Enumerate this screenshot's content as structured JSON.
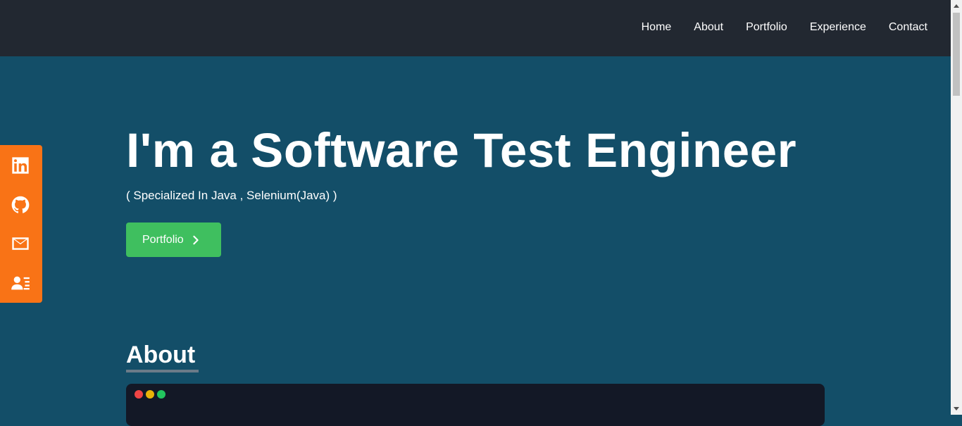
{
  "nav": {
    "items": [
      {
        "label": "Home"
      },
      {
        "label": "About"
      },
      {
        "label": "Portfolio"
      },
      {
        "label": "Experience"
      },
      {
        "label": "Contact"
      }
    ]
  },
  "hero": {
    "title": "I'm a Software Test Engineer",
    "subtitle": "( Specialized In Java , Selenium(Java) )",
    "cta_label": "Portfolio",
    "cta_icon": "chevron-right-icon"
  },
  "social": {
    "icons": [
      "linkedin-icon",
      "github-icon",
      "mail-icon",
      "contact-card-icon"
    ],
    "bg_color": "#f97316"
  },
  "about": {
    "heading": "About"
  },
  "terminal": {
    "dots": [
      "#ef4444",
      "#eab308",
      "#22c55e"
    ]
  },
  "colors": {
    "nav_bg": "#222831",
    "page_bg": "#134e68",
    "accent_green": "#3fbf5f"
  }
}
